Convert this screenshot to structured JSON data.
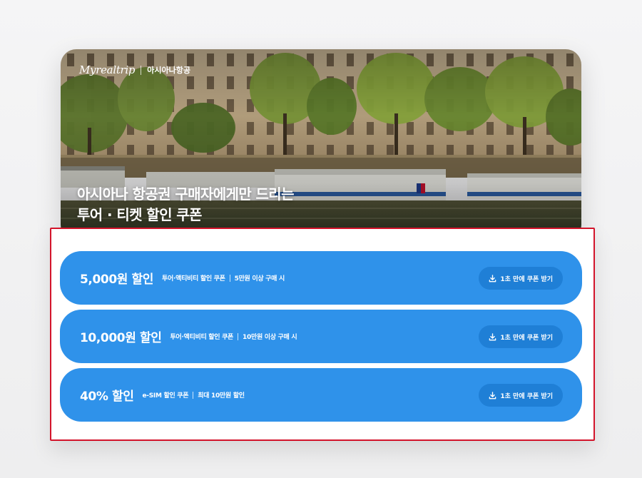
{
  "hero": {
    "brand_logo": "Myrealtrip",
    "brand_partner": "아시아나항공",
    "title_line1": "아시아나 항공권 구매자에게만 드리는",
    "title_line2": "투어 · 티켓 할인 쿠폰"
  },
  "coupons": [
    {
      "amount": "5,000원 할인",
      "category": "투어·액티비티 할인 쿠폰",
      "condition": "5만원 이상 구매 시",
      "button": "1초 만에 쿠폰 받기"
    },
    {
      "amount": "10,000원 할인",
      "category": "투어·액티비티 할인 쿠폰",
      "condition": "10만원 이상 구매 시",
      "button": "1초 만에 쿠폰 받기"
    },
    {
      "amount": "40% 할인",
      "category": "e-SIM 할인 쿠폰",
      "condition": "최대 10만원 할인",
      "button": "1초 만에 쿠폰 받기"
    }
  ],
  "colors": {
    "coupon_bg": "#2f92ea",
    "button_bg": "#1f7fd6",
    "highlight_border": "#d3142b"
  },
  "icons": {
    "download": "download-icon"
  }
}
